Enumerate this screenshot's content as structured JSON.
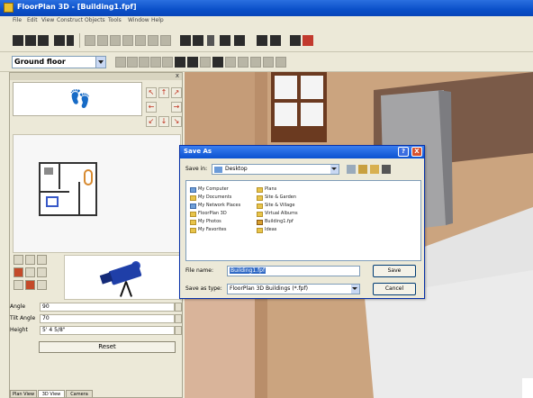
{
  "window": {
    "title": "FloorPlan 3D - [Building1.fpf]"
  },
  "menu": {
    "items": [
      "File",
      "Edit",
      "View",
      "Construct",
      "Objects",
      "Tools",
      "Window",
      "Help"
    ]
  },
  "toolbar": {
    "floor_select": "Ground floor"
  },
  "left_panel": {
    "close_glyph": "x",
    "properties": [
      {
        "label": "Angle",
        "value": "90"
      },
      {
        "label": "Tilt Angle",
        "value": "70"
      },
      {
        "label": "Height",
        "value": "5' 4 5/8\""
      }
    ],
    "reset_label": "Reset",
    "tabs": [
      "Plan View",
      "3D View",
      "Camera"
    ]
  },
  "dialog": {
    "title": "Save As",
    "help_glyph": "?",
    "close_glyph": "X",
    "save_in_label": "Save in:",
    "save_in_value": "Desktop",
    "items": [
      {
        "name": "My Computer",
        "icon": "computer-icon"
      },
      {
        "name": "My Documents",
        "icon": "folder-icon"
      },
      {
        "name": "My Network Places",
        "icon": "network-icon"
      },
      {
        "name": "FloorPlan 3D",
        "icon": "folder-icon"
      },
      {
        "name": "My Photos",
        "icon": "folder-icon"
      },
      {
        "name": "My Favorites",
        "icon": "folder-icon"
      },
      {
        "name": "Plans",
        "icon": "folder-icon"
      },
      {
        "name": "Site & Garden",
        "icon": "folder-icon"
      },
      {
        "name": "Site & Village",
        "icon": "folder-icon"
      },
      {
        "name": "Virtual Albums",
        "icon": "folder-icon"
      },
      {
        "name": "Building1.fpf",
        "icon": "fpf-file-icon"
      },
      {
        "name": "Ideas",
        "icon": "folder-icon"
      }
    ],
    "file_name_label": "File name:",
    "file_name_value": "Building1.fpf",
    "save_type_label": "Save as type:",
    "save_type_value": "FloorPlan 3D Buildings (*.fpf)",
    "save_button": "Save",
    "cancel_button": "Cancel"
  },
  "colors": {
    "titlebar": "#0a4fc8",
    "wall": "#c9a27f",
    "window_frame": "#6b3a20",
    "floor": "#e6e6e6"
  }
}
